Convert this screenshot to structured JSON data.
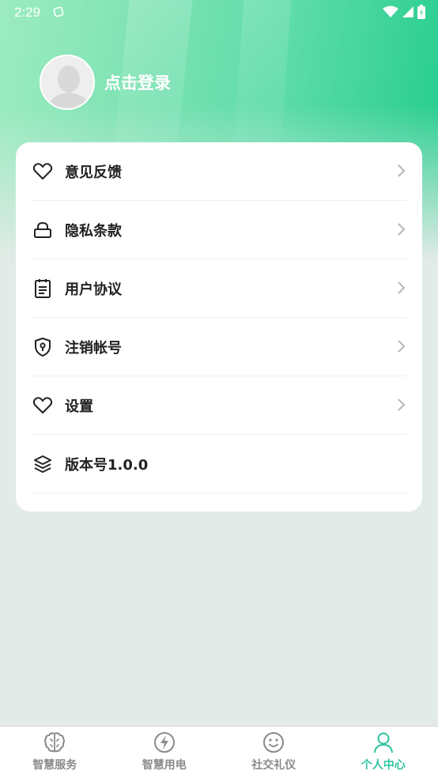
{
  "status_bar": {
    "time": "2:29"
  },
  "profile": {
    "login_label": "点击登录"
  },
  "menu": {
    "items": [
      {
        "label": "意见反馈",
        "icon": "heart-icon",
        "has_arrow": true
      },
      {
        "label": "隐私条款",
        "icon": "lock-icon",
        "has_arrow": true
      },
      {
        "label": "用户协议",
        "icon": "clipboard-icon",
        "has_arrow": true
      },
      {
        "label": "注销帐号",
        "icon": "shield-keyhole-icon",
        "has_arrow": true
      },
      {
        "label": "设置",
        "icon": "heart-icon",
        "has_arrow": true
      },
      {
        "label": "版本号1.0.0",
        "icon": "layers-icon",
        "has_arrow": false
      }
    ]
  },
  "tabbar": {
    "tabs": [
      {
        "label": "智慧服务",
        "icon": "brain-icon",
        "active": false
      },
      {
        "label": "智慧用电",
        "icon": "lightning-icon",
        "active": false
      },
      {
        "label": "社交礼仪",
        "icon": "smiley-icon",
        "active": false
      },
      {
        "label": "个人中心",
        "icon": "person-icon",
        "active": true
      }
    ]
  },
  "colors": {
    "accent": "#2ec4a0",
    "header_gradient_start": "#9cecc0",
    "header_gradient_end": "#22cc8c",
    "background": "#e2ebe7"
  }
}
